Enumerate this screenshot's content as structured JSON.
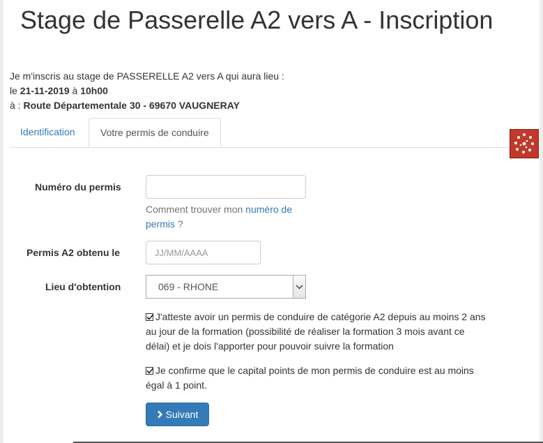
{
  "page": {
    "title": "Stage de Passerelle A2 vers A - Inscription"
  },
  "intro": {
    "line1": "Je m'inscris au stage de PASSERELLE A2 vers A qui aura lieu :",
    "date_prefix": "le ",
    "date": "21-11-2019",
    "time_prefix": " à ",
    "time": "10h00",
    "place_prefix": "à : ",
    "place": "Route Départementale 30 - 69670 VAUGNERAY"
  },
  "tabs": [
    {
      "label": "Identification",
      "active": false
    },
    {
      "label": "Votre permis de conduire",
      "active": true
    }
  ],
  "form": {
    "license_number": {
      "label": "Numéro du permis",
      "value": "",
      "placeholder": ""
    },
    "help": {
      "prefix": "Comment trouver mon ",
      "link": "numéro de permis",
      "suffix": " ?"
    },
    "obtained_date": {
      "label": "Permis A2 obtenu le",
      "value": "",
      "placeholder": "JJ/MM/AAAA"
    },
    "place_obtained": {
      "label": "Lieu d'obtention",
      "selected": "069 - RHONE"
    },
    "attest_checkbox": {
      "checked": true,
      "text": "J'atteste avoir un permis de conduire de catégorie A2 depuis au moins 2 ans au jour de la formation (possibilité de réaliser la formation 3 mois avant ce délai) et je dois l'apporter pour pouvoir suivre la formation"
    },
    "points_checkbox": {
      "checked": true,
      "text": "Je confirme que le capital points de mon permis de conduire est au moins égal à 1 point."
    },
    "next_button": {
      "label": "Suivant",
      "icon": "chevron-right-icon"
    }
  },
  "side_widget": {
    "icon": "network-icon",
    "color": "#c0392b"
  },
  "colors": {
    "link": "#337ab7",
    "primary_button": "#337ab7",
    "text": "#333333",
    "help_text": "#737373"
  }
}
